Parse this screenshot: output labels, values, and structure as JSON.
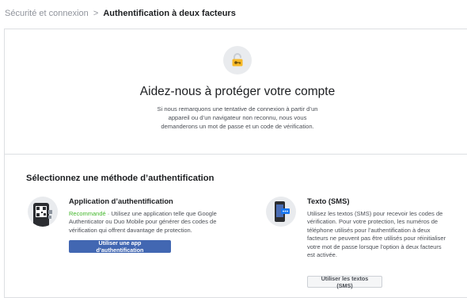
{
  "breadcrumb": {
    "parent": "Sécurité et connexion",
    "separator": ">",
    "current": "Authentification à deux facteurs"
  },
  "hero": {
    "icon": "lock-key-icon",
    "title": "Aidez-nous à protéger votre compte",
    "description": "Si nous remarquons une tentative de connexion à partir d’un appareil ou d’un navigateur non reconnu, nous vous demanderons un mot de passe et un code de vérification."
  },
  "methods": {
    "section_title": "Sélectionnez une méthode d’authentification",
    "app": {
      "icon": "qr-phone-icon",
      "title": "Application d’authentification",
      "recommended": "Recommandé",
      "separator": " · ",
      "description": "Utilisez une application telle que Google Authenticator ou Duo Mobile pour générer des codes de vérification qui offrent davantage de protection.",
      "button": "Utiliser une app d’authentification"
    },
    "sms": {
      "icon": "sms-phone-icon",
      "title": "Texto (SMS)",
      "description": "Utilisez les textos (SMS) pour recevoir les codes de vérification. Pour votre protection, les numéros de téléphone utilisés pour l’authentification à deux facteurs ne peuvent pas être utilisés pour réinitialiser votre mot de passe lorsque l’option à deux facteurs est activée.",
      "button": "Utiliser les textos (SMS)"
    }
  },
  "colors": {
    "primary": "#4267b2",
    "recommended": "#42b72a",
    "lock": "#f7b928",
    "muted_text": "#90949c",
    "border": "#dddfe2"
  }
}
